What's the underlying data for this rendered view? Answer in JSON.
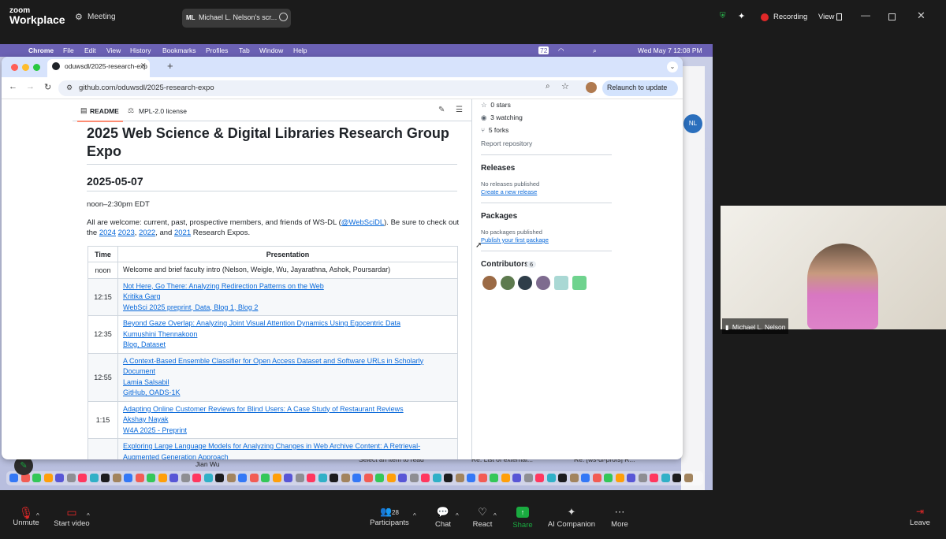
{
  "zoom": {
    "logo_line1": "zoom",
    "logo_line2": "Workplace",
    "meeting_label": "Meeting",
    "share_chip": "Michael L. Nelson's scr...",
    "share_initials": "ML",
    "recording_label": "Recording",
    "view_label": "View",
    "participant_name": "Michael L. Nelson",
    "other_participant": "Jian Wu",
    "controls": {
      "unmute": "Unmute",
      "start_video": "Start video",
      "participants": "Participants",
      "participants_count": "28",
      "chat": "Chat",
      "react": "React",
      "share": "Share",
      "ai_companion": "AI Companion",
      "more": "More",
      "leave": "Leave"
    },
    "colors": {
      "share_green": "#1aab40",
      "recording_red": "#e02828"
    }
  },
  "mac": {
    "menus": [
      "Chrome",
      "File",
      "Edit",
      "View",
      "History",
      "Bookmarks",
      "Profiles",
      "Tab",
      "Window",
      "Help"
    ],
    "battery": "72",
    "clock": "Wed May 7  12:08 PM"
  },
  "browser": {
    "tab_title": "oduwsdl/2025-research-exp",
    "url": "github.com/oduwsdl/2025-research-expo",
    "relaunch": "Relaunch to update"
  },
  "readme": {
    "tab_readme": "README",
    "tab_license": "MPL-2.0 license",
    "title": "2025 Web Science & Digital Libraries Research Group Expo",
    "date": "2025-05-07",
    "time": "noon–2:30pm EDT",
    "intro_pre": "All are welcome: current, past, prospective members, and friends of WS-DL (",
    "intro_handle": "@WebSciDL",
    "intro_post": "). Be sure to check out",
    "intro_line2_pre": "the ",
    "years": [
      "2024",
      "2023",
      "2022",
      "2021"
    ],
    "intro_line2_post": " Research Expos.",
    "col_time": "Time",
    "col_presentation": "Presentation",
    "rows": [
      {
        "time": "noon",
        "lines": [
          "Welcome and brief faculty intro (Nelson, Weigle, Wu, Jayarathna, Ashok, Poursardar)"
        ]
      },
      {
        "time": "12:15",
        "lines": [
          "Not Here, Go There: Analyzing Redirection Patterns on the Web",
          "Kritika Garg",
          "WebSci 2025 preprint, Data, Blog 1, Blog 2"
        ]
      },
      {
        "time": "12:35",
        "lines": [
          "Beyond Gaze Overlap: Analyzing Joint Visual Attention Dynamics Using Egocentric Data",
          "Kumushini Thennakoon",
          "Blog, Dataset"
        ]
      },
      {
        "time": "12:55",
        "lines": [
          "A Context-Based Ensemble Classifier for Open Access Dataset and Software URLs in Scholarly",
          "Document",
          "Lamia Salsabil",
          "GitHub, OADS-1K"
        ]
      },
      {
        "time": "1:15",
        "lines": [
          "Adapting Online Customer Reviews for Blind Users: A Case Study of Restaurant Reviews",
          "Akshay Nayak",
          "W4A 2025 - Preprint"
        ]
      },
      {
        "time": "",
        "lines": [
          "Exploring Large Language Models for Analyzing Changes in Web Archive Content: A Retrieval-",
          "Augmented Generation Approach"
        ]
      }
    ]
  },
  "sidebar": {
    "stars": "0 stars",
    "watching": "3 watching",
    "forks": "5 forks",
    "report": "Report repository",
    "releases_h": "Releases",
    "releases_none": "No releases published",
    "releases_link": "Create a new release",
    "packages_h": "Packages",
    "packages_none": "No packages published",
    "packages_link": "Publish your first package",
    "contributors_h": "Contributors",
    "contributors_count": "6",
    "other_window_initials": "NL"
  },
  "mail_strip": {
    "select_hint": "Select an item to read",
    "item1": "Re: List of external...",
    "item2": "Re: [ws-dl-profs] R..."
  }
}
